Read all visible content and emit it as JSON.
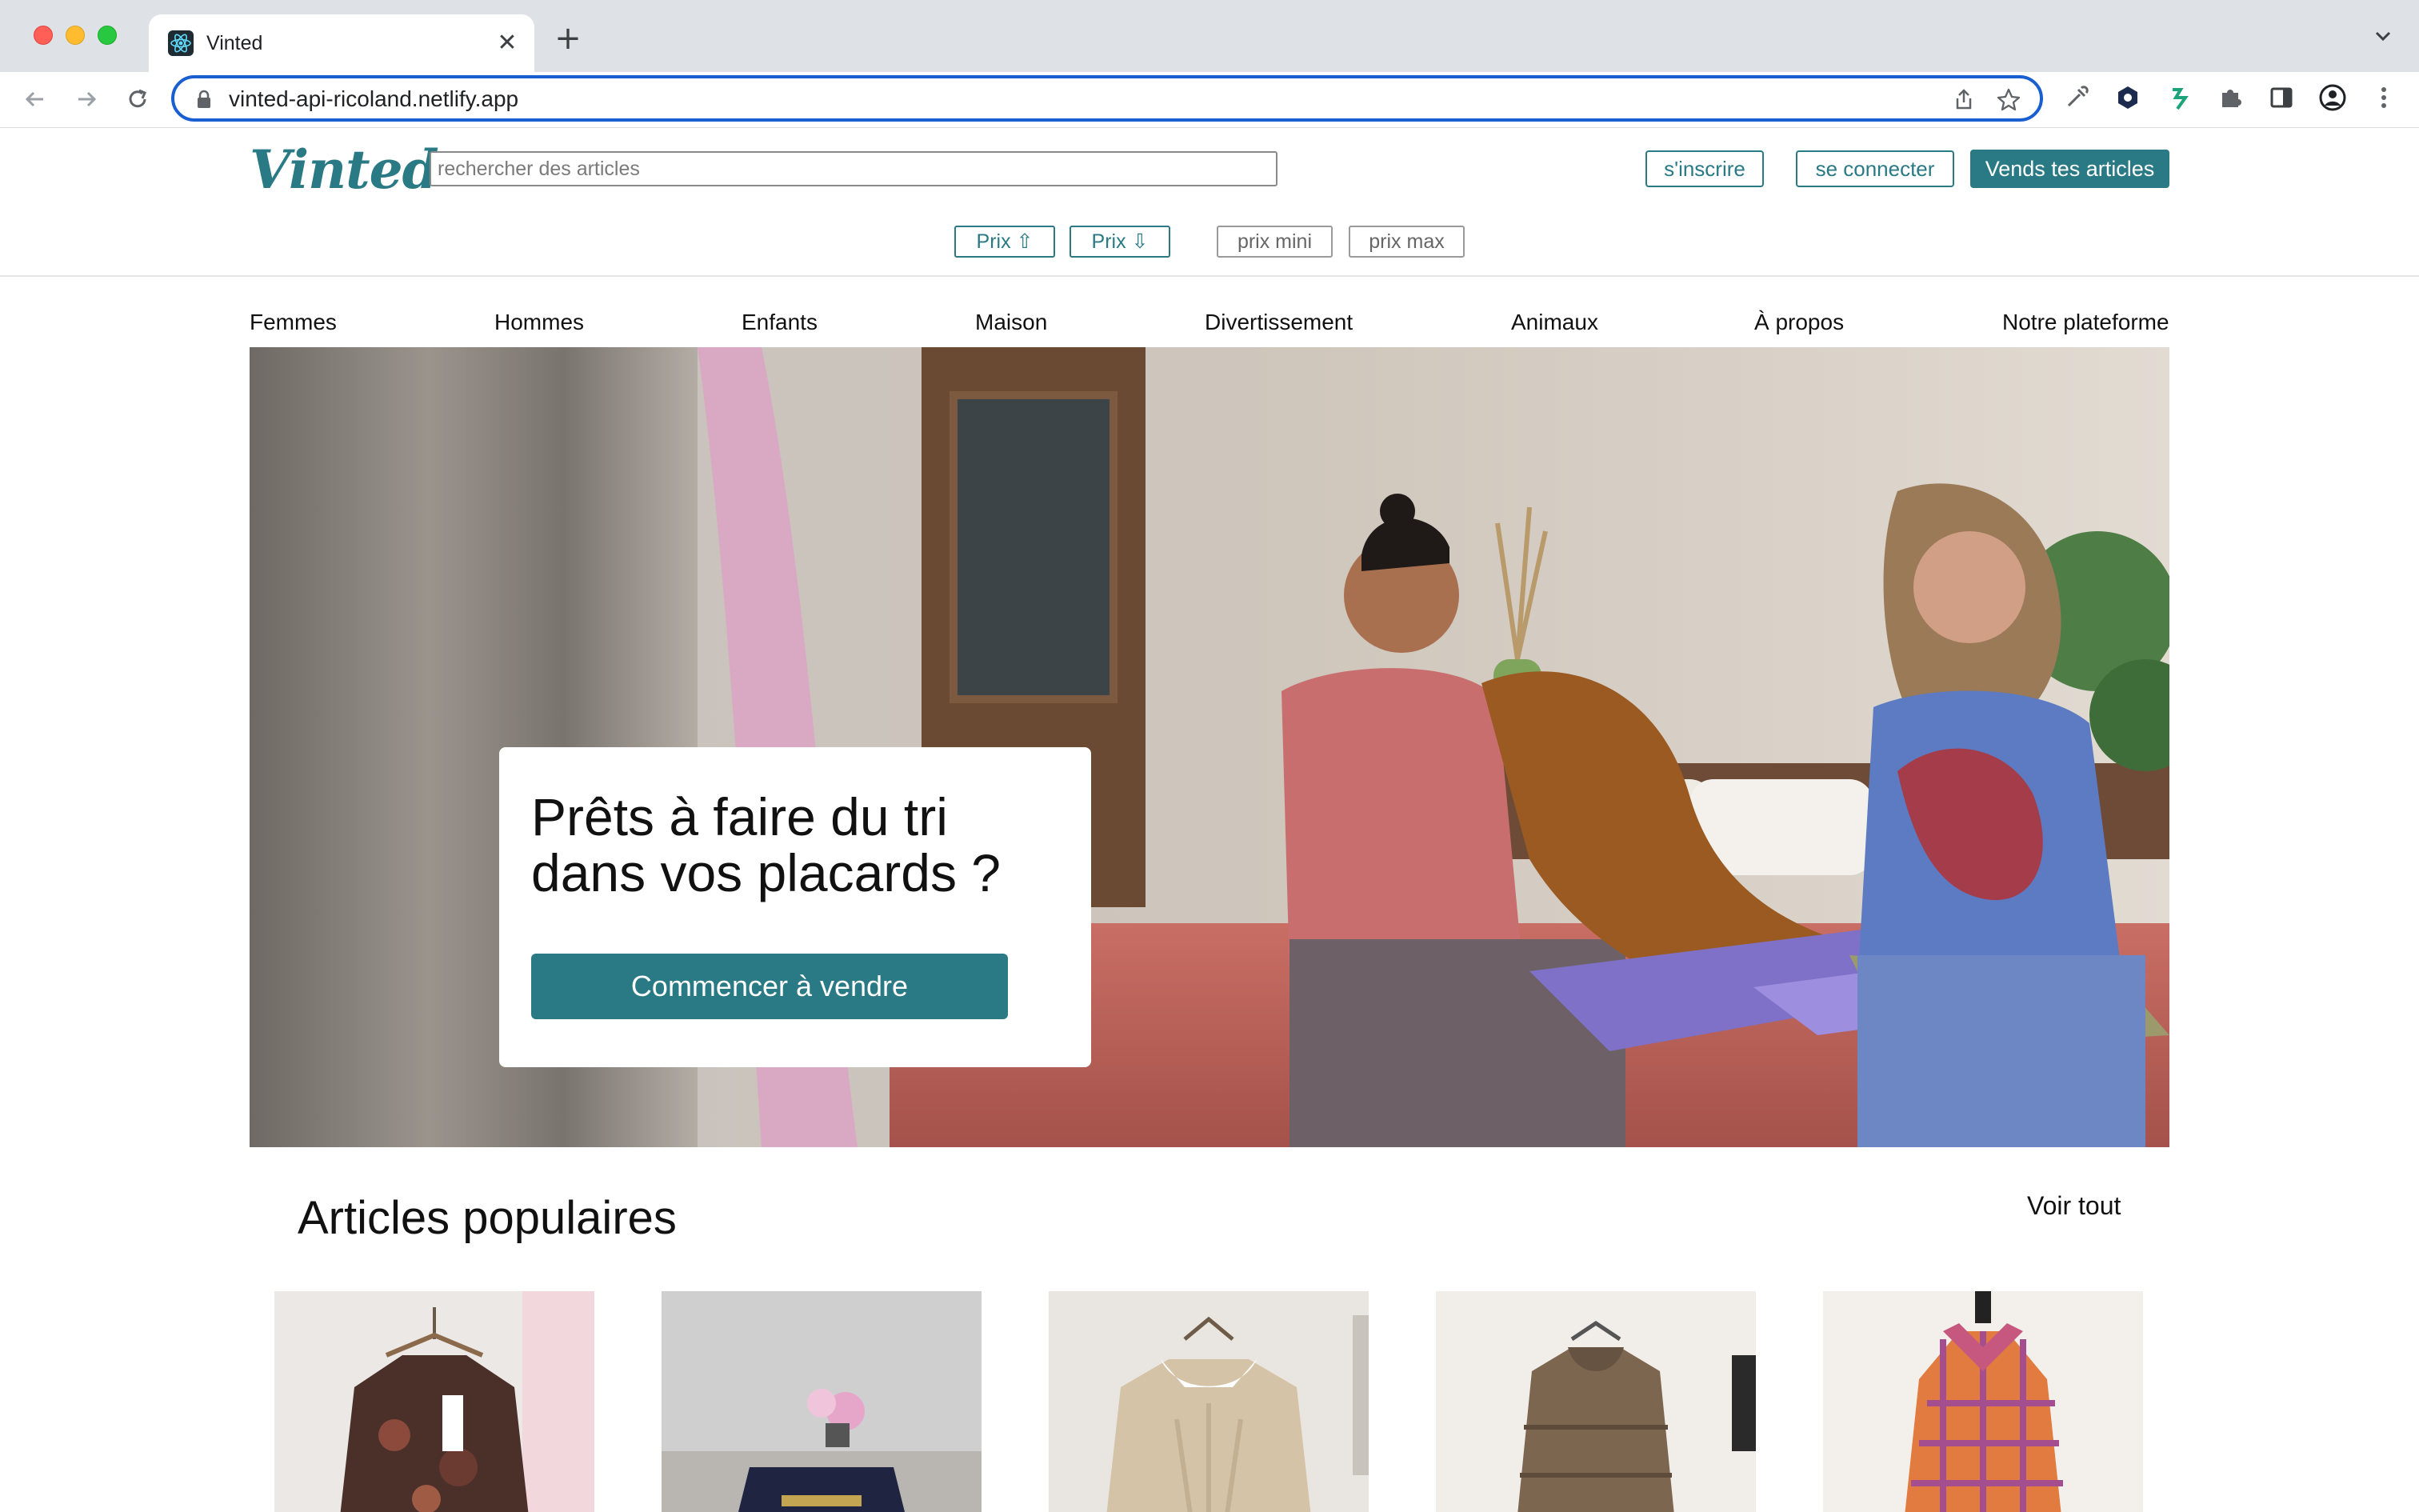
{
  "browser": {
    "tab_title": "Vinted",
    "url": "vinted-api-ricoland.netlify.app"
  },
  "header": {
    "logo": "Vinted",
    "search_placeholder": "rechercher des articles",
    "signup_label": "s'inscrire",
    "login_label": "se connecter",
    "sell_label": "Vends tes articles"
  },
  "filters": {
    "price_asc": "Prix ⇧",
    "price_desc": "Prix ⇩",
    "price_min": "prix mini",
    "price_max": "prix max"
  },
  "categories": [
    "Femmes",
    "Hommes",
    "Enfants",
    "Maison",
    "Divertissement",
    "Animaux",
    "À propos",
    "Notre plateforme"
  ],
  "hero": {
    "title_line1": "Prêts à faire du tri",
    "title_line2": "dans vos placards ?",
    "cta_label": "Commencer à vendre"
  },
  "popular": {
    "title": "Articles populaires",
    "see_all": "Voir tout"
  },
  "colors": {
    "brand": "#2a7a85",
    "focus_ring": "#1a5fd1"
  }
}
